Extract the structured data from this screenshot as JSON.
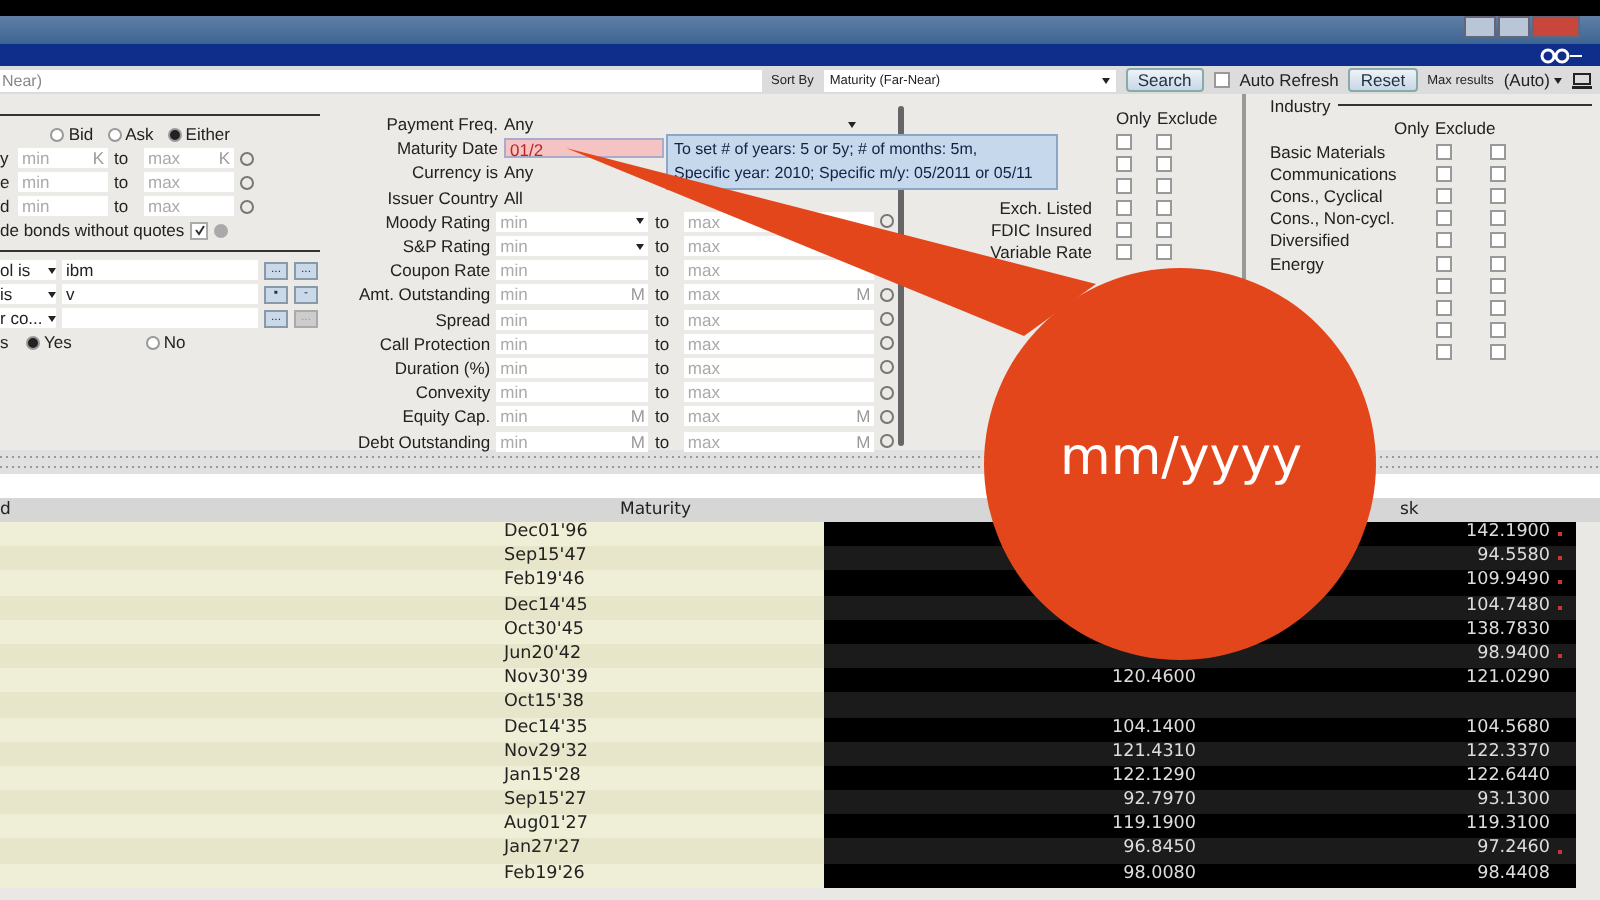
{
  "search_bar": {
    "query": "Near)",
    "sort_label": "Sort By",
    "sort_value": "Maturity (Far-Near)",
    "search_button": "Search",
    "auto_refresh": {
      "label": "Auto Refresh",
      "checked": false
    },
    "reset_button": "Reset",
    "max_results_label": "Max results",
    "max_results_value": "(Auto)"
  },
  "left_panel": {
    "quote_side": [
      {
        "label": "Bid",
        "selected": false
      },
      {
        "label": "Ask",
        "selected": false
      },
      {
        "label": "Either",
        "selected": true
      }
    ],
    "ranges": [
      {
        "label": "y",
        "min": "min",
        "to": "to",
        "max": "max",
        "min_unit": "K",
        "max_unit": "K"
      },
      {
        "label": "e",
        "min": "min",
        "to": "to",
        "max": "max"
      },
      {
        "label": "d",
        "min": "min",
        "to": "to",
        "max": "max"
      }
    ],
    "no_quotes": {
      "label": "de bonds without quotes",
      "checked": true
    },
    "conditions": [
      {
        "field": "ol is",
        "value": "ibm",
        "buttons": [
          {
            "text": "...",
            "disabled": false
          },
          {
            "text": "...",
            "disabled": false
          }
        ]
      },
      {
        "field": "is",
        "value": "v",
        "buttons": [
          {
            "text": "▪",
            "disabled": false
          },
          {
            "text": "-",
            "disabled": false
          }
        ]
      },
      {
        "field": "r co...",
        "buttons": [
          {
            "text": "...",
            "disabled": false
          },
          {
            "text": "...",
            "disabled": true
          }
        ]
      }
    ],
    "yes_no": {
      "label": "s",
      "options": [
        {
          "label": "Yes",
          "selected": true
        },
        {
          "label": "No",
          "selected": false
        }
      ]
    }
  },
  "criteria": [
    {
      "kind": "select",
      "label": "Payment Freq.",
      "value": "Any"
    },
    {
      "kind": "input",
      "label": "Maturity Date",
      "value": "01/2"
    },
    {
      "kind": "plain",
      "label": "Currency is",
      "value": "Any"
    },
    {
      "kind": "plain",
      "label": "Issuer Country",
      "value": "All"
    },
    {
      "kind": "range",
      "label": "Moody Rating",
      "min": "min",
      "to": "to",
      "max": "max",
      "dropdown": true
    },
    {
      "kind": "range",
      "label": "S&P Rating",
      "min": "min",
      "to": "to",
      "max": "max",
      "dropdown": true
    },
    {
      "kind": "range",
      "label": "Coupon Rate",
      "min": "min",
      "to": "to",
      "max": "max"
    },
    {
      "kind": "range",
      "label": "Amt. Outstanding",
      "min": "min",
      "to": "to",
      "max": "max",
      "min_unit": "M",
      "max_unit": "M"
    },
    {
      "kind": "range",
      "label": "Spread",
      "min": "min",
      "to": "to",
      "max": "max"
    },
    {
      "kind": "range",
      "label": "Call Protection",
      "min": "min",
      "to": "to",
      "max": "max"
    },
    {
      "kind": "range",
      "label": "Duration (%)",
      "min": "min",
      "to": "to",
      "max": "max"
    },
    {
      "kind": "range",
      "label": "Convexity",
      "min": "min",
      "to": "to",
      "max": "max"
    },
    {
      "kind": "range",
      "label": "Equity Cap.",
      "min": "min",
      "to": "to",
      "max": "max",
      "min_unit": "M",
      "max_unit": "M"
    },
    {
      "kind": "range",
      "label": "Debt Outstanding",
      "min": "min",
      "to": "to",
      "max": "max",
      "min_unit": "M",
      "max_unit": "M"
    }
  ],
  "tooltip": {
    "lines": [
      "To set # of years: 5 or 5y; # of months: 5m,",
      "Specific year: 2010; Specific m/y: 05/2011 or 05/11"
    ]
  },
  "flags": {
    "headers": [
      "Only",
      "Exclude"
    ],
    "rows": [
      {
        "only": false,
        "exclude": false
      },
      {
        "only": false,
        "exclude": false
      },
      {
        "only": false,
        "exclude": false
      },
      {
        "label": "Exch. Listed",
        "only": false,
        "exclude": false
      },
      {
        "label": "FDIC Insured",
        "only": false,
        "exclude": false
      },
      {
        "label": "Variable Rate",
        "only": false,
        "exclude": false
      }
    ]
  },
  "industry": {
    "title": "Industry",
    "headers": [
      "Only",
      "Exclude"
    ],
    "rows": [
      {
        "label": "Basic Materials",
        "only": false,
        "exclude": false
      },
      {
        "label": "Communications",
        "only": false,
        "exclude": false
      },
      {
        "label": "Cons., Cyclical",
        "only": false,
        "exclude": false
      },
      {
        "label": "Cons., Non-cycl.",
        "only": false,
        "exclude": false
      },
      {
        "label": "Diversified",
        "only": false,
        "exclude": false
      },
      {
        "label": "Energy",
        "only": false,
        "exclude": false
      },
      {
        "only": false,
        "exclude": false
      },
      {
        "only": false,
        "exclude": false
      },
      {
        "only": false,
        "exclude": false
      },
      {
        "only": false,
        "exclude": false
      }
    ]
  },
  "table": {
    "columns": [
      "d",
      "Maturity",
      "sk"
    ],
    "rows": [
      {
        "maturity": "Dec01'96",
        "ask": "142.1900",
        "marked": true
      },
      {
        "maturity": "Sep15'47",
        "ask": "94.5580",
        "marked": true
      },
      {
        "maturity": "Feb19'46",
        "ask": "109.9490",
        "marked": true
      },
      {
        "maturity": "Dec14'45",
        "ask": "104.7480",
        "marked": true
      },
      {
        "maturity": "Oct30'45",
        "ask": "138.7830",
        "marked": false
      },
      {
        "maturity": "Jun20'42",
        "ask": "98.9400",
        "marked": true
      },
      {
        "maturity": "Nov30'39",
        "bid": "120.4600",
        "ask": "121.0290",
        "marked": false
      },
      {
        "maturity": "Oct15'38",
        "marked": false
      },
      {
        "maturity": "Dec14'35",
        "bid": "104.1400",
        "ask": "104.5680",
        "marked": false
      },
      {
        "maturity": "Nov29'32",
        "bid": "121.4310",
        "ask": "122.3370",
        "marked": false
      },
      {
        "maturity": "Jan15'28",
        "bid": "122.1290",
        "ask": "122.6440",
        "marked": false
      },
      {
        "maturity": "Sep15'27",
        "bid": "92.7970",
        "ask": "93.1300",
        "marked": false
      },
      {
        "maturity": "Aug01'27",
        "bid": "119.1900",
        "ask": "119.3100",
        "marked": false
      },
      {
        "maturity": "Jan27'27",
        "bid": "96.8450",
        "ask": "97.2460",
        "marked": true
      },
      {
        "maturity": "Feb19'26",
        "bid": "98.0080",
        "ask": "98.4408",
        "marked": false
      }
    ]
  },
  "callout": {
    "text": "mm/yyyy"
  }
}
